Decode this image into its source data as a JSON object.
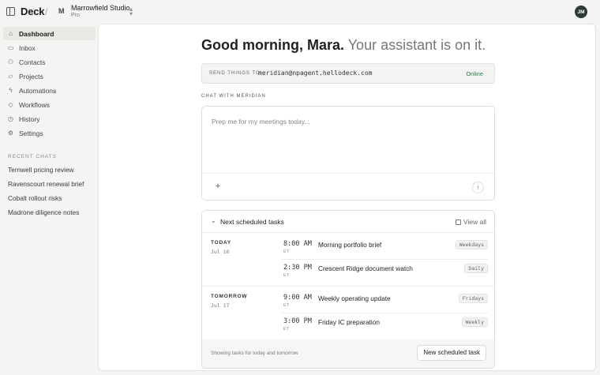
{
  "app": {
    "brand": "Deck"
  },
  "workspace": {
    "icon_letter": "M",
    "name": "Marrowfield Studio",
    "plan": "Pro"
  },
  "user": {
    "initials": "JM"
  },
  "sidebar": {
    "items": [
      {
        "label": "Dashboard",
        "icon": "home-icon",
        "active": true
      },
      {
        "label": "Inbox",
        "icon": "inbox-icon"
      },
      {
        "label": "Contacts",
        "icon": "contacts-icon"
      },
      {
        "label": "Projects",
        "icon": "folder-icon"
      },
      {
        "label": "Automations",
        "icon": "bolt-icon"
      },
      {
        "label": "Workflows",
        "icon": "workflow-icon"
      },
      {
        "label": "History",
        "icon": "history-icon"
      },
      {
        "label": "Settings",
        "icon": "gear-icon"
      }
    ],
    "recent_label": "RECENT CHATS",
    "recent_chats": [
      "Ternwell pricing review",
      "Ravenscourt renewal brief",
      "Cobalt rollout risks",
      "Madrone diligence notes"
    ]
  },
  "main": {
    "greeting": "Good morning, Mara.",
    "greeting_sub": "Your assistant is on it.",
    "send_label": "SEND THINGS TO",
    "send_email": "meridian@npagent.hellodeck.com",
    "send_status": "Online",
    "chat_label": "CHAT WITH MERIDIAN",
    "chat_placeholder": "Prep me for my meetings today..."
  },
  "tasks": {
    "title": "Next scheduled tasks",
    "view_all": "View all",
    "days": [
      {
        "name": "TODAY",
        "date": "Jul 16",
        "tasks": [
          {
            "time": "8:00 AM",
            "tz": "ET",
            "name": "Morning portfolio brief",
            "badge": "Weekdays"
          },
          {
            "time": "2:30 PM",
            "tz": "ET",
            "name": "Crescent Ridge document watch",
            "badge": "Daily"
          }
        ]
      },
      {
        "name": "TOMORROW",
        "date": "Jul 17",
        "tasks": [
          {
            "time": "9:00 AM",
            "tz": "ET",
            "name": "Weekly operating update",
            "badge": "Fridays"
          },
          {
            "time": "3:00 PM",
            "tz": "ET",
            "name": "Friday IC preparation",
            "badge": "Weekly"
          }
        ]
      }
    ],
    "footer_text": "Showing tasks for today and tomorrow",
    "new_task_label": "New scheduled task"
  },
  "colors": {
    "online": "#2e7a44",
    "avatar_bg": "#2d3b36"
  }
}
